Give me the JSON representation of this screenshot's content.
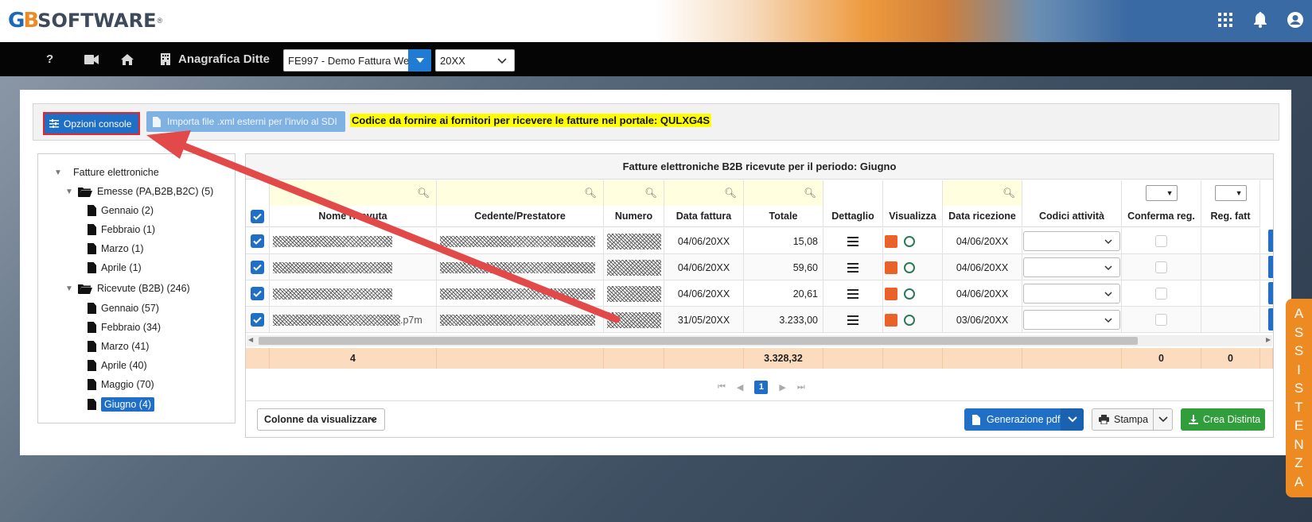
{
  "brand": {
    "logo_mark": "GB",
    "logo_text": "SOFTWARE",
    "logo_reg": "®"
  },
  "colors": {
    "accent": "#1f6fc7",
    "brand_orange": "#ee8a22",
    "highlight": "#ffff00",
    "success": "#2f9e3b",
    "totals_bg": "#fcdcbf"
  },
  "topbar": {
    "icons": [
      "apps-grid-icon",
      "bell-icon",
      "user-icon"
    ]
  },
  "nav": {
    "help": "?",
    "anagrafica_label": "Anagrafica Ditte",
    "ditta_value": "FE997 - Demo Fattura We",
    "year_value": "20XX"
  },
  "toolbar": {
    "opzioni_label": "Opzioni console",
    "importa_label": "Importa file .xml esterni per l'invio al SDI",
    "codice_text": "Codice da fornire ai fornitori per ricevere le fatture nel portale: QULXG4S"
  },
  "tree": {
    "root": "Fatture elettroniche",
    "emesse": "Emesse (PA,B2B,B2C) (5)",
    "emesse_items": [
      "Gennaio (2)",
      "Febbraio (1)",
      "Marzo (1)",
      "Aprile (1)"
    ],
    "ricevute": "Ricevute (B2B) (246)",
    "ricevute_items": [
      "Gennaio (57)",
      "Febbraio (34)",
      "Marzo (41)",
      "Aprile (40)",
      "Maggio (70)",
      "Giugno (4)"
    ]
  },
  "grid": {
    "title": "Fatture elettroniche B2B ricevute per il periodo: Giugno",
    "columns": [
      "Nome ricevuta",
      "Cedente/Prestatore",
      "Numero",
      "Data fattura",
      "Totale",
      "Dettaglio",
      "Visualizza",
      "Data ricezione",
      "Codici attività",
      "Conferma reg.",
      "Reg. fatt"
    ],
    "rows": [
      {
        "name_suffix": "",
        "data_fattura": "04/06/20XX",
        "totale": "15,08",
        "data_ricezione": "04/06/20XX"
      },
      {
        "name_suffix": "",
        "data_fattura": "04/06/20XX",
        "totale": "59,60",
        "data_ricezione": "04/06/20XX"
      },
      {
        "name_suffix": "",
        "data_fattura": "04/06/20XX",
        "totale": "20,61",
        "data_ricezione": "04/06/20XX"
      },
      {
        "name_suffix": ".p7m",
        "data_fattura": "31/05/20XX",
        "totale": "3.233,00",
        "data_ricezione": "03/06/20XX"
      }
    ],
    "totals": {
      "count": "4",
      "totale": "3.328,32",
      "conferma": "0",
      "reg": "0"
    },
    "pager": {
      "current": "1"
    }
  },
  "footer": {
    "colonne_label": "Colonne da visualizzare",
    "pdf_label": "Generazione pdf",
    "stampa_label": "Stampa",
    "distinta_label": "Crea Distinta"
  },
  "assistenza": [
    "A",
    "S",
    "S",
    "I",
    "S",
    "T",
    "E",
    "N",
    "Z",
    "A"
  ]
}
